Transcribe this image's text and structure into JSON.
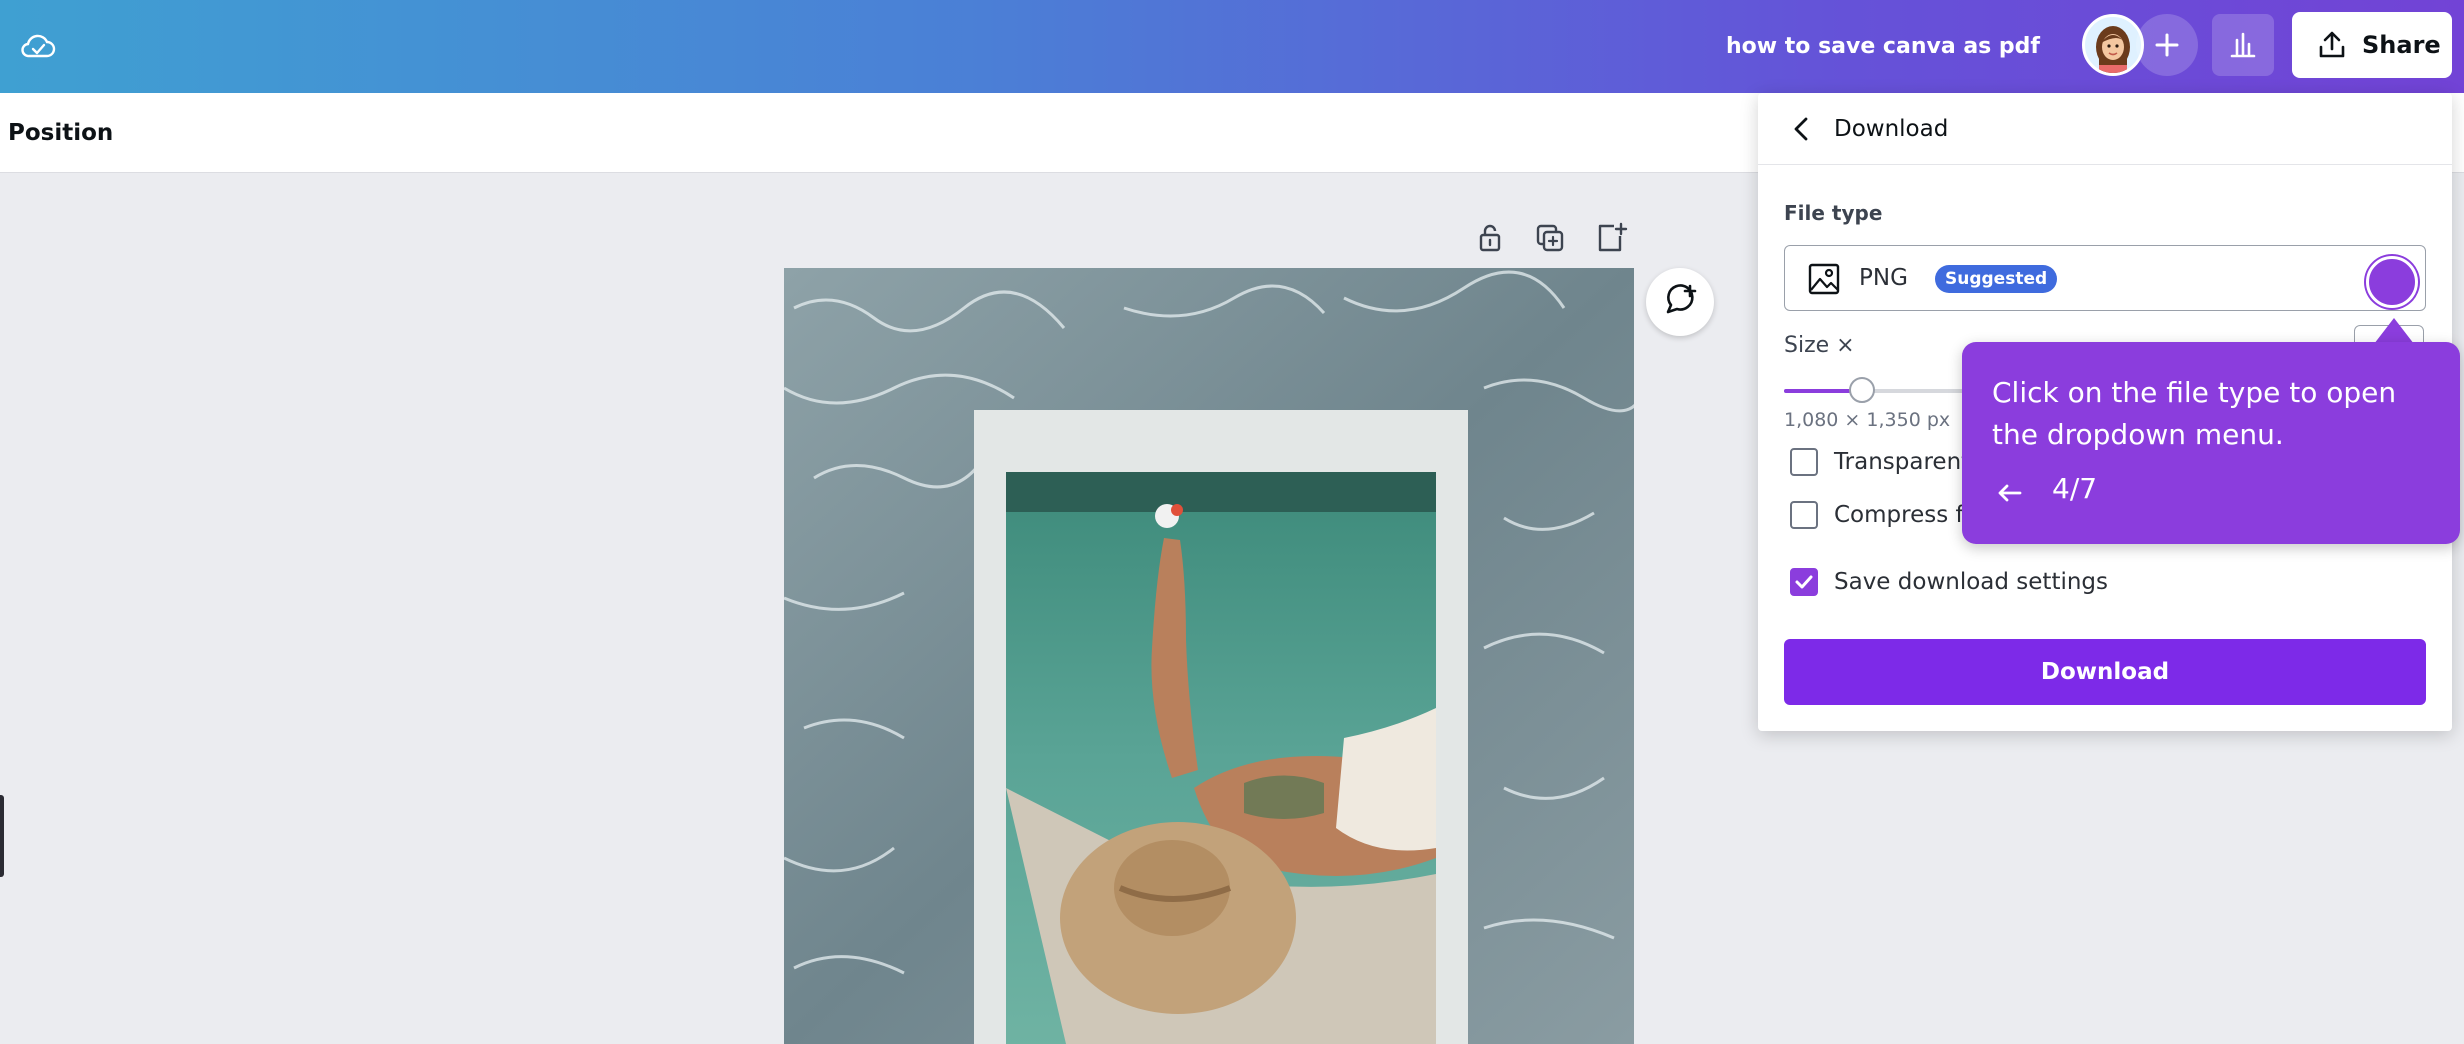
{
  "topbar": {
    "doc_title": "how to save canva as pdf",
    "share_label": "Share",
    "icons": [
      "cloud-saved-icon",
      "avatar",
      "plus-icon",
      "bar-chart-icon",
      "upload-icon"
    ]
  },
  "toolbar": {
    "position_label": "Position"
  },
  "download_panel": {
    "title": "Download",
    "file_type_label": "File type",
    "file_type_value": "PNG",
    "suggested_badge": "Suggested",
    "size_label": "Size ×",
    "size_dims": "1,080 × 1,350 px",
    "size_slider_fraction": 0.14,
    "options": [
      {
        "label": "Transparent",
        "checked": false
      },
      {
        "label": "Compress fi",
        "checked": false
      },
      {
        "label": "Save download settings",
        "checked": true
      }
    ],
    "download_button": "Download"
  },
  "tooltip": {
    "text": "Click on the file type to open the dropdown menu.",
    "step": "4/7"
  },
  "colors": {
    "accent": "#8b3ddd",
    "button": "#7d2ae8",
    "badge": "#3f6bde"
  }
}
